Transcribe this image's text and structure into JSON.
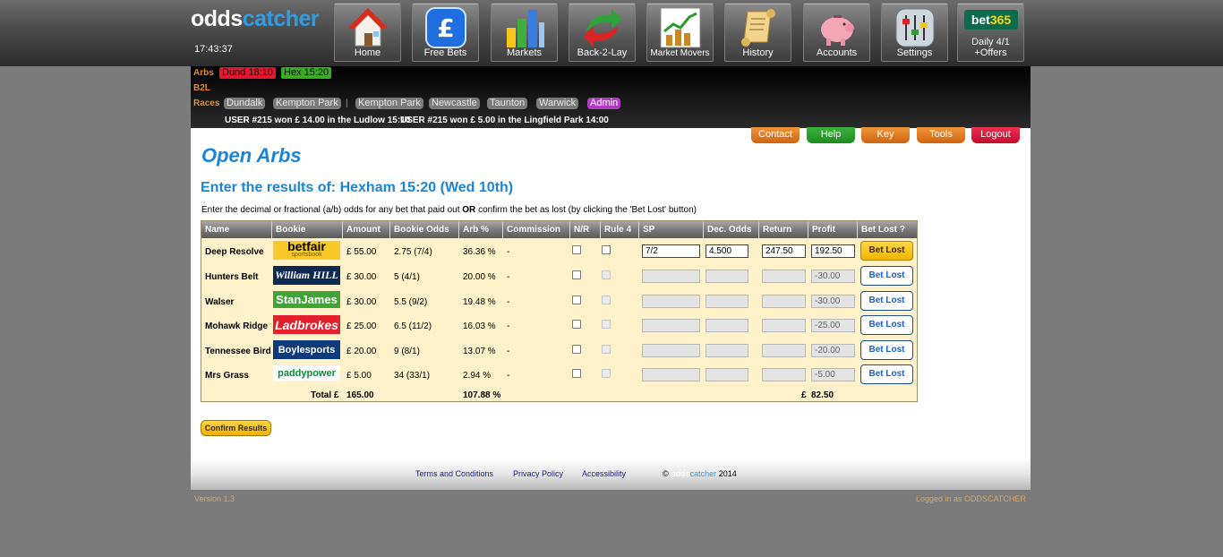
{
  "header": {
    "logo_part1": "odds",
    "logo_part2": "catcher",
    "clock": "17:43:37",
    "nav": [
      {
        "label": "Home"
      },
      {
        "label": "Free Bets"
      },
      {
        "label": "Markets"
      },
      {
        "label": "Back-2-Lay"
      },
      {
        "label": "Market Movers"
      },
      {
        "label": "History"
      },
      {
        "label": "Accounts"
      },
      {
        "label": "Settings"
      },
      {
        "label_line1": "Daily 4/1",
        "label_line2": "+Offers",
        "logo_a": "bet",
        "logo_b": "365"
      }
    ]
  },
  "band": {
    "arbs_label": "Arbs",
    "arbs": [
      "Dund 18:10",
      "Hex 15:20"
    ],
    "b2l_label": "B2L",
    "races_label": "Races",
    "races_group1": [
      "Dundalk",
      "Kempton Park"
    ],
    "separator": "|",
    "races_group2": [
      "Kempton Park",
      "Newcastle",
      "Taunton",
      "Warwick"
    ],
    "admin": "Admin",
    "ticker": [
      "USER #215 won £ 14.00 in the Ludlow 15:10",
      "USER #215 won £ 5.00 in the Lingfield Park 14:00"
    ]
  },
  "topbuttons": {
    "contact": "Contact",
    "help": "Help",
    "key": "Key",
    "tools": "Tools",
    "logout": "Logout"
  },
  "main": {
    "title": "Open Arbs",
    "subtitle": "Enter the results of: Hexham 15:20 (Wed 10th)",
    "instr_part1": "Enter the decimal or fractional (a/b) odds for any bet that paid out",
    "instr_or": "OR",
    "instr_part2": "confirm the bet as lost (by clicking the 'Bet Lost' button)",
    "confirm_label": "Confirm Results"
  },
  "table": {
    "headers": [
      "Name",
      "Bookie",
      "Amount",
      "Bookie Odds",
      "Arb %",
      "Commission",
      "N/R",
      "Rule 4",
      "SP",
      "Dec. Odds",
      "Return",
      "Profit",
      "Bet Lost ?"
    ],
    "bet_lost_label": "Bet Lost",
    "rows": [
      {
        "name": "Deep Resolve",
        "bookie": "betfair",
        "bookie_sub": "sportsbook",
        "amount": "£ 55.00",
        "odds": "2.75 (7/4)",
        "arb": "36.36 %",
        "commission": "-",
        "sp": "7/2",
        "dec": "4.500",
        "ret": "247.50",
        "profit": "192.50"
      },
      {
        "name": "Hunters Belt",
        "bookie": "William HILL",
        "amount": "£ 30.00",
        "odds": "5 (4/1)",
        "arb": "20.00 %",
        "commission": "-",
        "sp": "",
        "dec": "",
        "ret": "",
        "profit": "-30.00"
      },
      {
        "name": "Walser",
        "bookie": "StanJames",
        "amount": "£ 30.00",
        "odds": "5.5 (9/2)",
        "arb": "19.48 %",
        "commission": "-",
        "sp": "",
        "dec": "",
        "ret": "",
        "profit": "-30.00"
      },
      {
        "name": "Mohawk Ridge",
        "bookie": "Ladbrokes",
        "amount": "£ 25.00",
        "odds": "6.5 (11/2)",
        "arb": "16.03 %",
        "commission": "-",
        "sp": "",
        "dec": "",
        "ret": "",
        "profit": "-25.00"
      },
      {
        "name": "Tennessee Bird",
        "bookie": "Boylesports",
        "amount": "£ 20.00",
        "odds": "9 (8/1)",
        "arb": "13.07 %",
        "commission": "-",
        "sp": "",
        "dec": "",
        "ret": "",
        "profit": "-20.00"
      },
      {
        "name": "Mrs Grass",
        "bookie": "paddypower",
        "amount": "£ 5.00",
        "odds": "34 (33/1)",
        "arb": "2.94 %",
        "commission": "-",
        "sp": "",
        "dec": "",
        "ret": "",
        "profit": "-5.00"
      }
    ],
    "total_label": "Total £",
    "total_amount": "165.00",
    "total_arb": "107.88 %",
    "total_profit_currency": "£",
    "total_profit": "82.50"
  },
  "footer": {
    "terms": "Terms and Conditions",
    "privacy": "Privacy Policy",
    "accessibility": "Accessibility",
    "copy_symbol": "©",
    "copy_logo1": "odds",
    "copy_logo2": "catcher",
    "copy_year": "2014",
    "version": "Version 1.3",
    "logged_in": "Logged in as ODDSCATCHER"
  },
  "colors": {
    "accent": "#1b84d6",
    "brand_blue": "#2f9de6",
    "orange": "#e58b1e",
    "table_bg": "#fff1c9"
  }
}
